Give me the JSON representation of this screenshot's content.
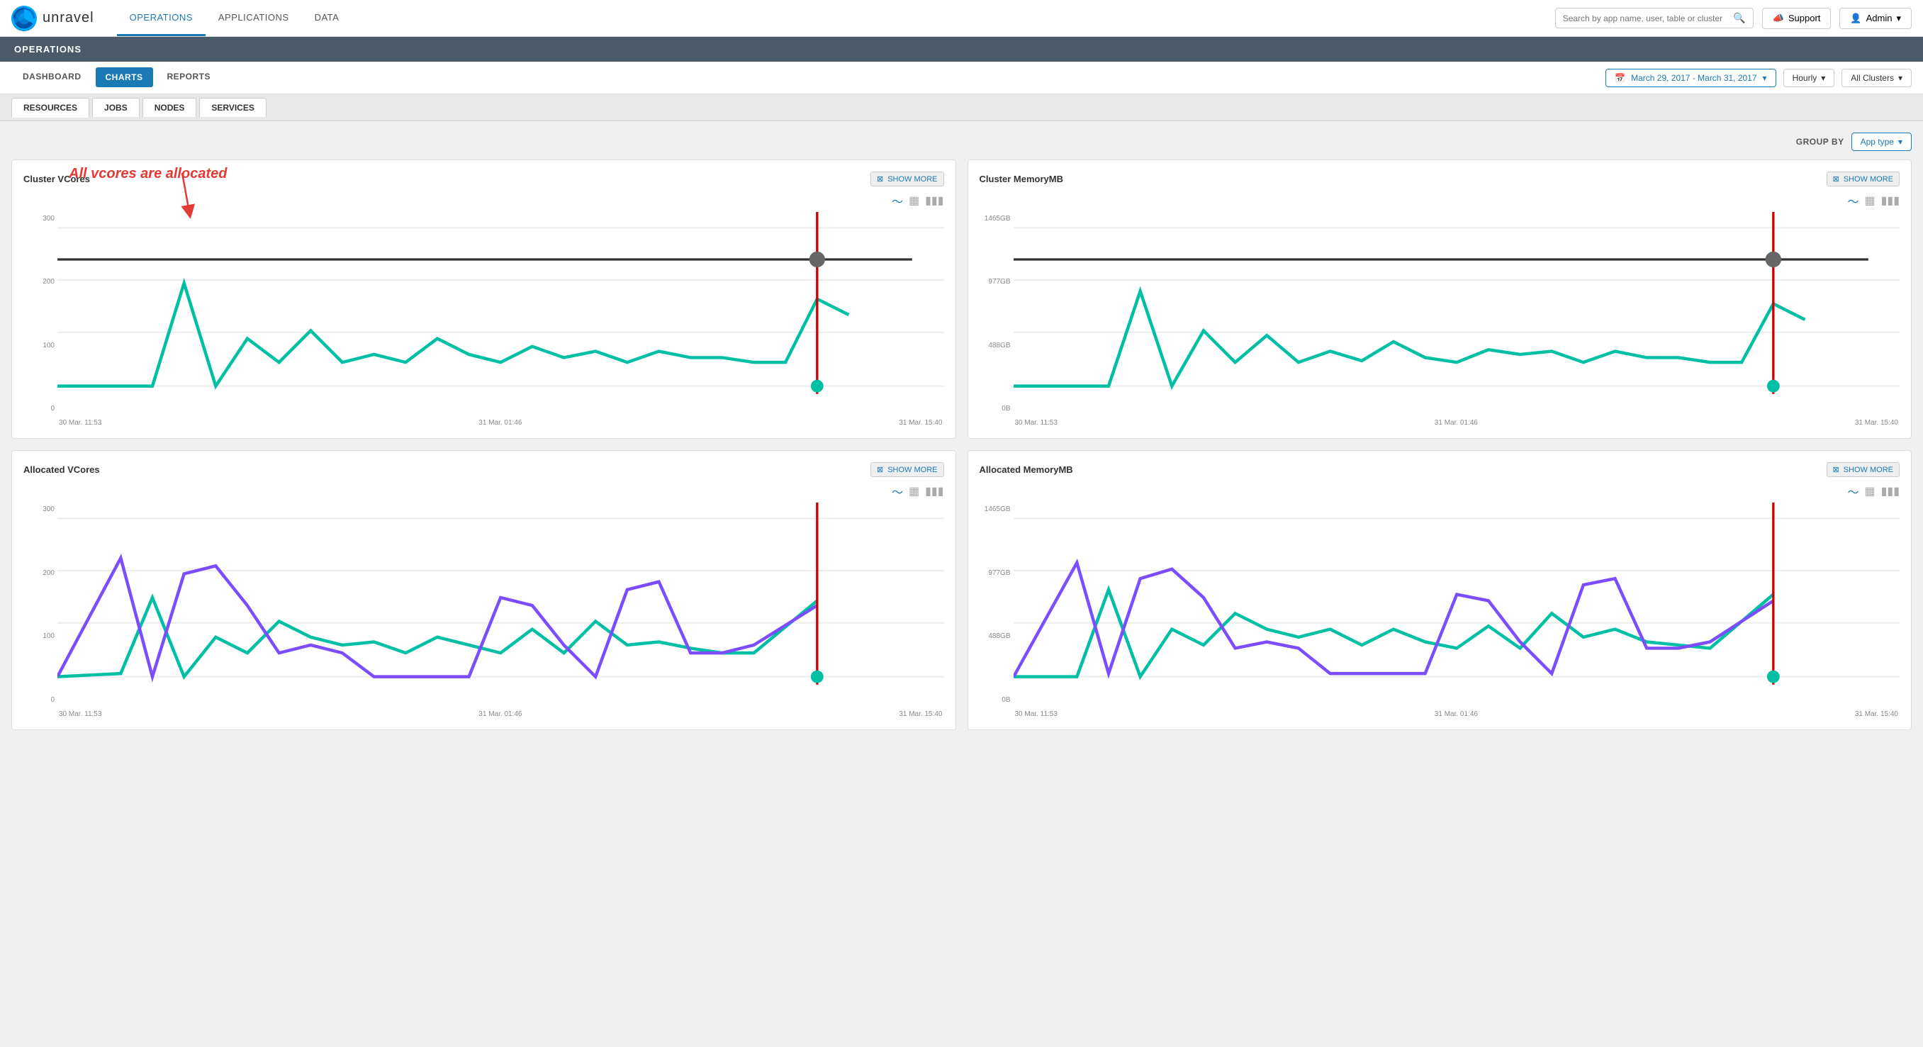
{
  "app": {
    "logo_text": "unravel"
  },
  "top_nav": {
    "links": [
      {
        "label": "OPERATIONS",
        "active": true
      },
      {
        "label": "APPLICATIONS",
        "active": false
      },
      {
        "label": "DATA",
        "active": false
      }
    ],
    "search_placeholder": "Search by app name, user, table or cluster",
    "support_label": "Support",
    "admin_label": "Admin"
  },
  "page_title": "OPERATIONS",
  "sub_nav": {
    "tabs": [
      {
        "label": "DASHBOARD",
        "active": false
      },
      {
        "label": "CHARTS",
        "active": true
      },
      {
        "label": "REPORTS",
        "active": false
      }
    ],
    "date_range": "March 29, 2017 - March 31, 2017",
    "hourly_label": "Hourly",
    "cluster_label": "All Clusters"
  },
  "secondary_tabs": [
    {
      "label": "RESOURCES",
      "active": true
    },
    {
      "label": "JOBS",
      "active": false
    },
    {
      "label": "NODES",
      "active": false
    },
    {
      "label": "SERVICES",
      "active": false
    }
  ],
  "group_by": {
    "label": "GROUP BY",
    "value": "App type"
  },
  "annotation": {
    "text": "All vcores are allocated"
  },
  "show_more_label": "SHOW MORE",
  "charts": [
    {
      "id": "cluster-vcores",
      "title": "Cluster VCores",
      "y_labels": [
        "300",
        "200",
        "100",
        "0"
      ],
      "x_labels": [
        "30 Mar. 11:53",
        "31 Mar. 01:46",
        "31 Mar. 15:40"
      ],
      "color": "#00bfa5",
      "has_annotation": true
    },
    {
      "id": "cluster-memorymb",
      "title": "Cluster MemoryMB",
      "y_labels": [
        "1465GB",
        "977GB",
        "488GB",
        "0B"
      ],
      "x_labels": [
        "30 Mar. 11:53",
        "31 Mar. 01:46",
        "31 Mar. 15:40"
      ],
      "color": "#00bfa5",
      "has_annotation": false
    },
    {
      "id": "allocated-vcores",
      "title": "Allocated VCores",
      "y_labels": [
        "300",
        "200",
        "100",
        "0"
      ],
      "x_labels": [
        "30 Mar. 11:53",
        "31 Mar. 01:46",
        "31 Mar. 15:40"
      ],
      "color": "#00bfa5",
      "has_annotation": false,
      "has_secondary": true
    },
    {
      "id": "allocated-memorymb",
      "title": "Allocated MemoryMB",
      "y_labels": [
        "1465GB",
        "977GB",
        "488GB",
        "0B"
      ],
      "x_labels": [
        "30 Mar. 11:53",
        "31 Mar. 01:46",
        "31 Mar. 15:40"
      ],
      "color": "#00bfa5",
      "has_annotation": false,
      "has_secondary": true
    }
  ]
}
